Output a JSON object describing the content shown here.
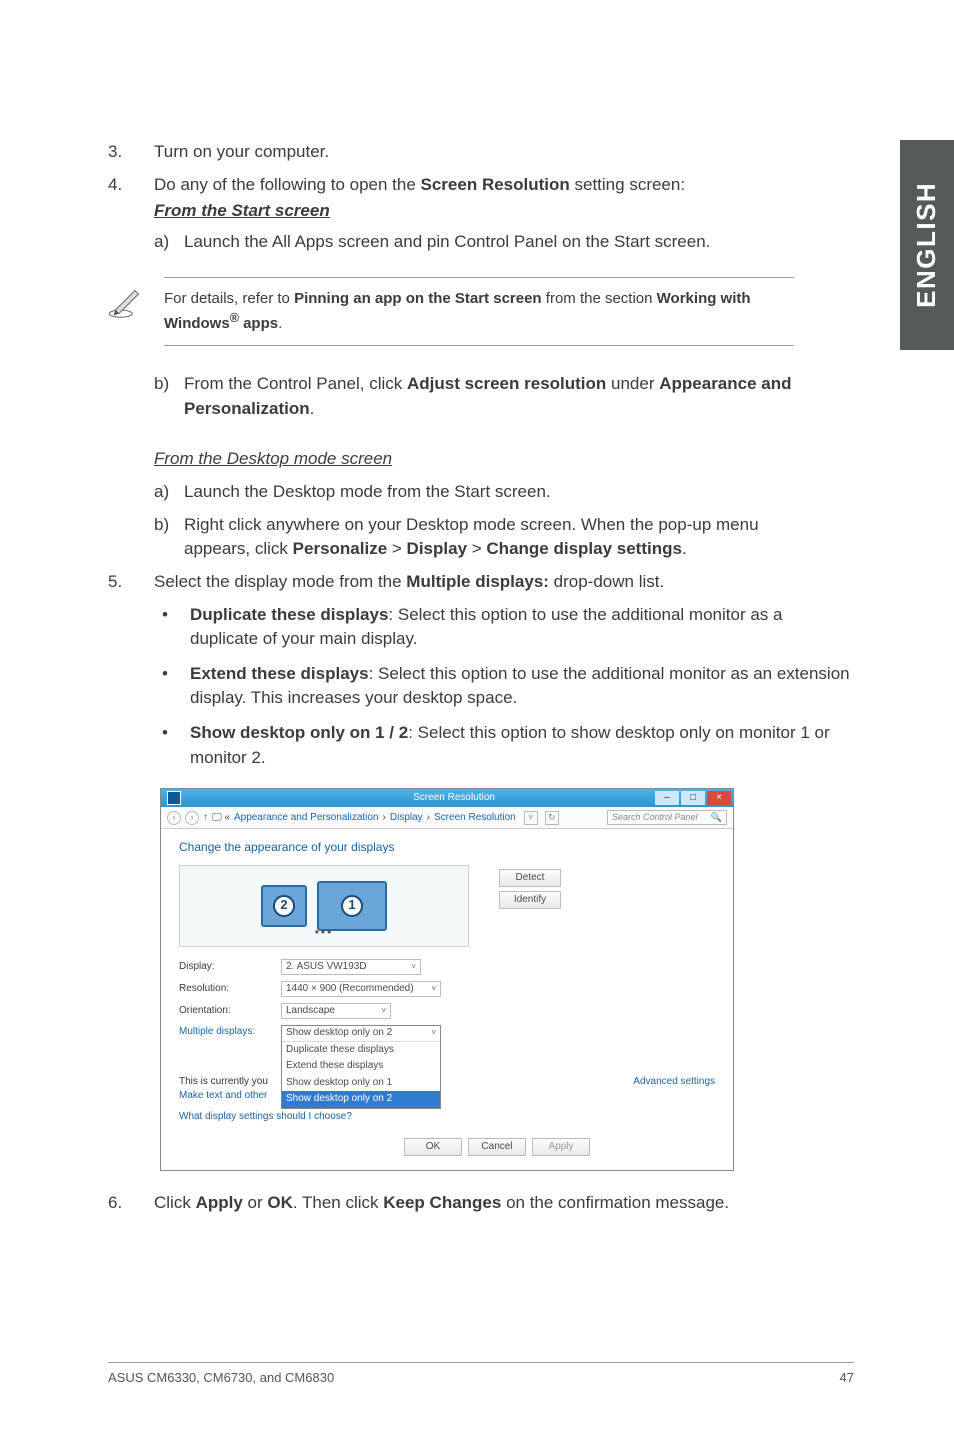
{
  "side_tab": "ENGLISH",
  "steps": {
    "s3": {
      "num": "3.",
      "text": "Turn on your computer."
    },
    "s4": {
      "num": "4.",
      "intro_pre": "Do any of the following to open the ",
      "intro_bold": "Screen Resolution",
      "intro_post": " setting screen:",
      "from_start": "From the Start screen",
      "a": {
        "letter": "a)",
        "text": "Launch the All Apps screen and pin Control Panel on the Start screen."
      },
      "b": {
        "letter": "b)",
        "pre": "From the Control Panel, click ",
        "bold1": "Adjust screen resolution",
        "mid": " under ",
        "bold2": "Appearance and Personalization",
        "end": "."
      },
      "from_desktop": "From the Desktop mode screen",
      "da": {
        "letter": "a)",
        "text": "Launch the Desktop mode from the Start screen."
      },
      "db": {
        "letter": "b)",
        "line1": "Right click anywhere on your Desktop mode screen. When the pop-up menu",
        "line2_pre": "appears, click ",
        "b1": "Personalize",
        "gt1": " > ",
        "b2": "Display",
        "gt2": " > ",
        "b3": "Change display settings",
        "end": "."
      }
    },
    "s5": {
      "num": "5.",
      "pre": "Select the display mode from the ",
      "bold": "Multiple displays:",
      "post": " drop-down list.",
      "bullets": {
        "dup": {
          "title": "Duplicate these displays",
          "rest": ": Select this option to use the additional monitor as a duplicate of your main display."
        },
        "ext": {
          "title": "Extend these displays",
          "rest": ": Select this option to use the additional monitor as an extension display. This increases your desktop space."
        },
        "show": {
          "title": "Show desktop only on 1 / 2",
          "rest": ": Select this option to show desktop only on monitor 1 or monitor 2."
        }
      }
    },
    "s6": {
      "num": "6.",
      "pre": "Click ",
      "b1": "Apply",
      "mid1": " or ",
      "b2": "OK",
      "mid2": ". Then click ",
      "b3": "Keep Changes",
      "post": " on the confirmation message."
    }
  },
  "note": {
    "pre": "For details, refer to ",
    "b1": "Pinning an app on the Start screen",
    "mid": " from the section ",
    "b2": "Working with Windows",
    "sup": "®",
    "b3": " apps",
    "end": "."
  },
  "shot": {
    "title": "Screen Resolution",
    "crumb1": "Appearance and Personalization",
    "crumb2": "Display",
    "crumb3": "Screen Resolution",
    "search_ph": "Search Control Panel",
    "heading": "Change the appearance of your displays",
    "mon1": "1",
    "mon2": "2",
    "btn_detect": "Detect",
    "btn_identify": "Identify",
    "rows": {
      "display": {
        "label": "Display:",
        "value": "2. ASUS VW193D"
      },
      "resolution": {
        "label": "Resolution:",
        "value": "1440 × 900 (Recommended)"
      },
      "orientation": {
        "label": "Orientation:",
        "value": "Landscape"
      },
      "multi": {
        "label": "Multiple displays:",
        "selected": "Show desktop only on 2"
      }
    },
    "dd_items": {
      "dup": "Duplicate these displays",
      "ext": "Extend these displays",
      "so1": "Show desktop only on 1",
      "so2": "Show desktop only on 2"
    },
    "main_note_pre": "This is currently you",
    "make_text": "Make text and other",
    "adv": "Advanced settings",
    "whatq": "What display settings should I choose?",
    "ok": "OK",
    "cancel": "Cancel",
    "apply": "Apply"
  },
  "footer": {
    "left": "ASUS CM6330, CM6730, and CM6830",
    "right": "47"
  },
  "glyphs": {
    "bullet": "•",
    "chev_right": "›",
    "chev_down": "˅",
    "mag": "🔍",
    "min": "–",
    "max": "□",
    "close": "×",
    "back": "‹",
    "fwd": "›",
    "up": "↑",
    "refresh": "↻"
  }
}
